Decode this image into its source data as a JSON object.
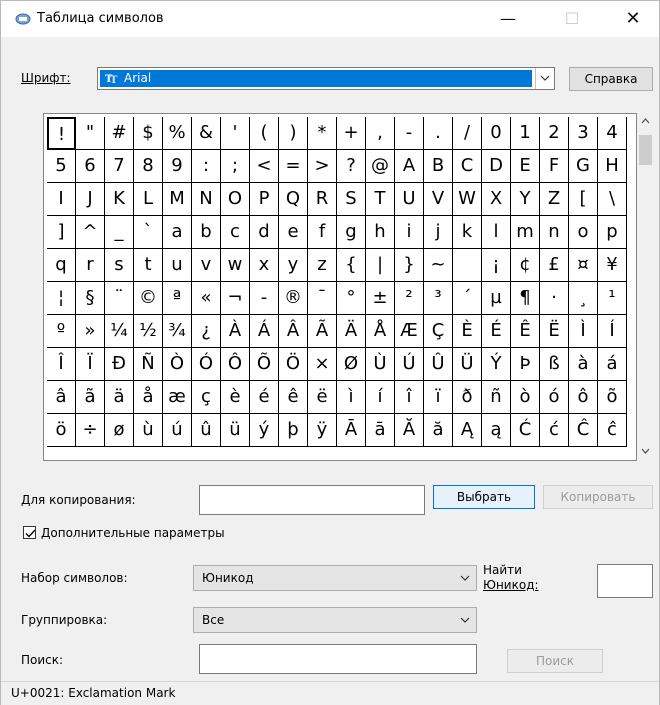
{
  "window": {
    "title": "Таблица символов"
  },
  "titlebar": {
    "minimize_glyph": "—",
    "maximize_glyph": "☐",
    "close_glyph": "✕"
  },
  "font": {
    "label": "Шрифт:",
    "value": "Arial"
  },
  "buttons": {
    "help": "Справка",
    "select": "Выбрать",
    "copy": "Копировать",
    "search": "Поиск"
  },
  "characters": [
    "!",
    "\"",
    "#",
    "$",
    "%",
    "&",
    "'",
    "(",
    ")",
    "*",
    "+",
    ",",
    "-",
    ".",
    "/",
    "0",
    "1",
    "2",
    "3",
    "4",
    "5",
    "6",
    "7",
    "8",
    "9",
    ":",
    ";",
    "<",
    "=",
    ">",
    "?",
    "@",
    "A",
    "B",
    "C",
    "D",
    "E",
    "F",
    "G",
    "H",
    "I",
    "J",
    "K",
    "L",
    "M",
    "N",
    "O",
    "P",
    "Q",
    "R",
    "S",
    "T",
    "U",
    "V",
    "W",
    "X",
    "Y",
    "Z",
    "[",
    "\\",
    "]",
    "^",
    "_",
    "`",
    "a",
    "b",
    "c",
    "d",
    "e",
    "f",
    "g",
    "h",
    "i",
    "j",
    "k",
    "l",
    "m",
    "n",
    "o",
    "p",
    "q",
    "r",
    "s",
    "t",
    "u",
    "v",
    "w",
    "x",
    "y",
    "z",
    "{",
    "|",
    "}",
    "~",
    " ",
    "¡",
    "¢",
    "£",
    "¤",
    "¥",
    "¦",
    "§",
    "¨",
    "©",
    "ª",
    "«",
    "¬",
    "-",
    "®",
    "¯",
    "°",
    "±",
    "²",
    "³",
    "´",
    "µ",
    "¶",
    "·",
    "¸",
    "¹",
    "º",
    "»",
    "¼",
    "½",
    "¾",
    "¿",
    "À",
    "Á",
    "Â",
    "Ã",
    "Ä",
    "Å",
    "Æ",
    "Ç",
    "È",
    "É",
    "Ê",
    "Ë",
    "Ì",
    "Í",
    "Î",
    "Ï",
    "Ð",
    "Ñ",
    "Ò",
    "Ó",
    "Ô",
    "Õ",
    "Ö",
    "×",
    "Ø",
    "Ù",
    "Ú",
    "Û",
    "Ü",
    "Ý",
    "Þ",
    "ß",
    "à",
    "á",
    "â",
    "ã",
    "ä",
    "å",
    "æ",
    "ç",
    "è",
    "é",
    "ê",
    "ë",
    "ì",
    "í",
    "î",
    "ï",
    "ð",
    "ñ",
    "ò",
    "ó",
    "ô",
    "õ",
    "ö",
    "÷",
    "ø",
    "ù",
    "ú",
    "û",
    "ü",
    "ý",
    "þ",
    "ÿ",
    "Ā",
    "ā",
    "Ă",
    "ă",
    "Ą",
    "ą",
    "Ć",
    "ć",
    "Ĉ",
    "ĉ"
  ],
  "copy_field": {
    "label": "Для копирования:",
    "value": ""
  },
  "advanced": {
    "label": "Дополнительные параметры",
    "checked": true
  },
  "charset": {
    "label": "Набор символов:",
    "value": "Юникод"
  },
  "find_unicode": {
    "label_line1": "Найти",
    "label_line2": "Юникод:",
    "value": ""
  },
  "grouping": {
    "label": "Группировка:",
    "value": "Все"
  },
  "search": {
    "label": "Поиск:",
    "value": ""
  },
  "status": {
    "text": "U+0021: Exclamation Mark"
  }
}
